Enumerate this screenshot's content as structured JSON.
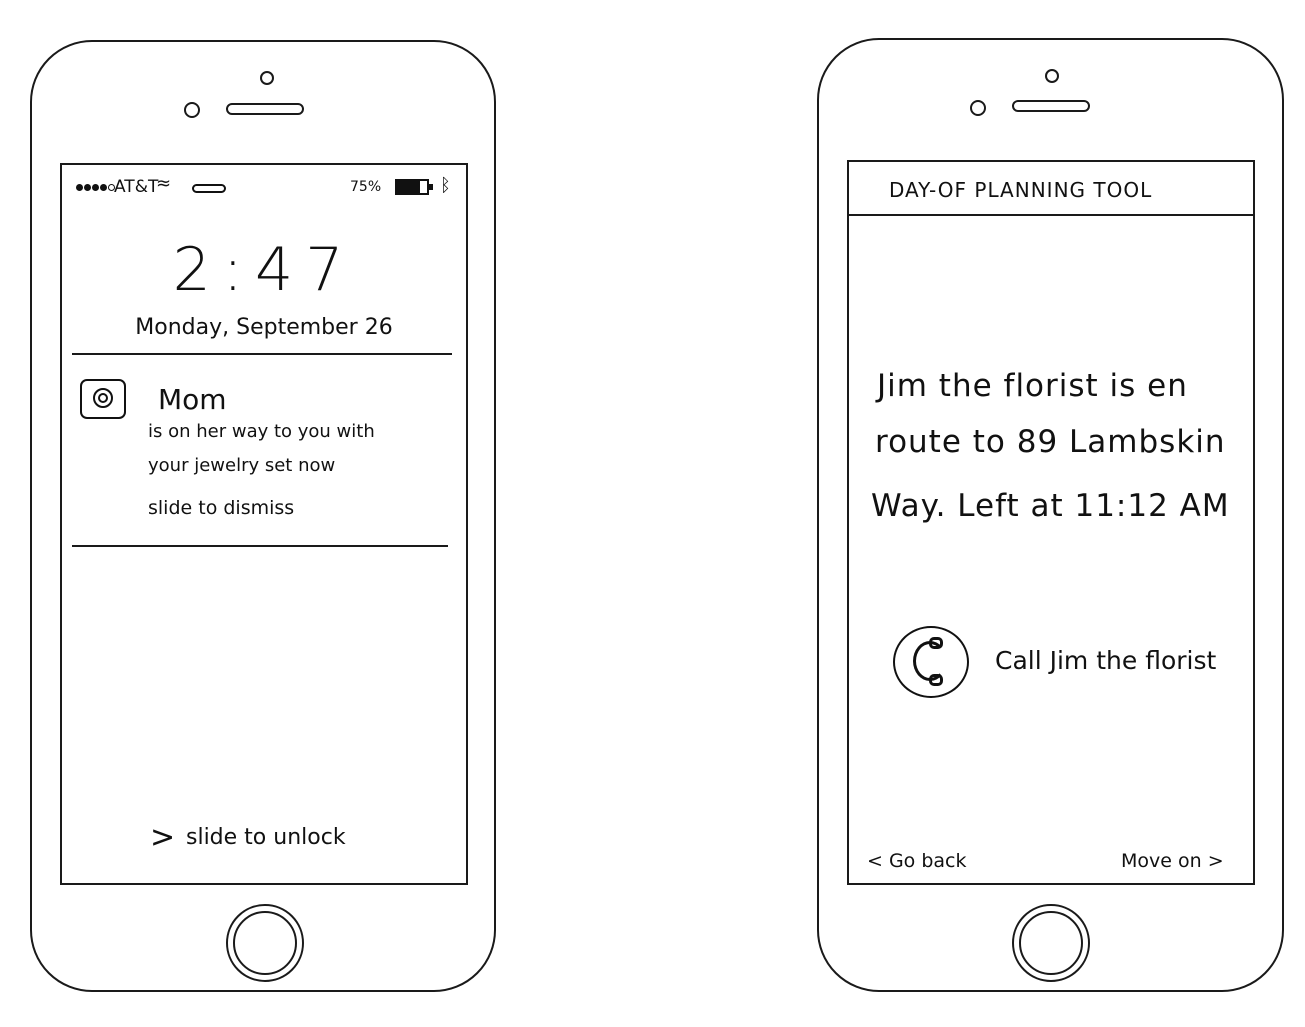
{
  "lock_screen": {
    "status": {
      "carrier": "AT&T",
      "wifi_icon": "wifi-icon",
      "battery_percent": "75%",
      "battery_level": 0.75,
      "bluetooth_icon": "bluetooth-icon"
    },
    "time": "2:47",
    "date": "Monday, September 26",
    "notification": {
      "app_icon": "ring-icon",
      "title": "Mom",
      "line1": "is on her way to you with",
      "line2": "your jewelry set now",
      "action": "slide to dismiss"
    },
    "unlock_chevron": ">",
    "unlock_text": "slide to unlock"
  },
  "planning_screen": {
    "title": "DAY-OF PLANNING TOOL",
    "message_line1": "Jim the florist is en",
    "message_line2": "route to 89 Lambskin",
    "message_line3": "Way. Left at 11:12 AM",
    "call_icon": "phone-icon",
    "call_label": "Call Jim the florist",
    "back_label": "< Go back",
    "next_label": "Move on >"
  }
}
